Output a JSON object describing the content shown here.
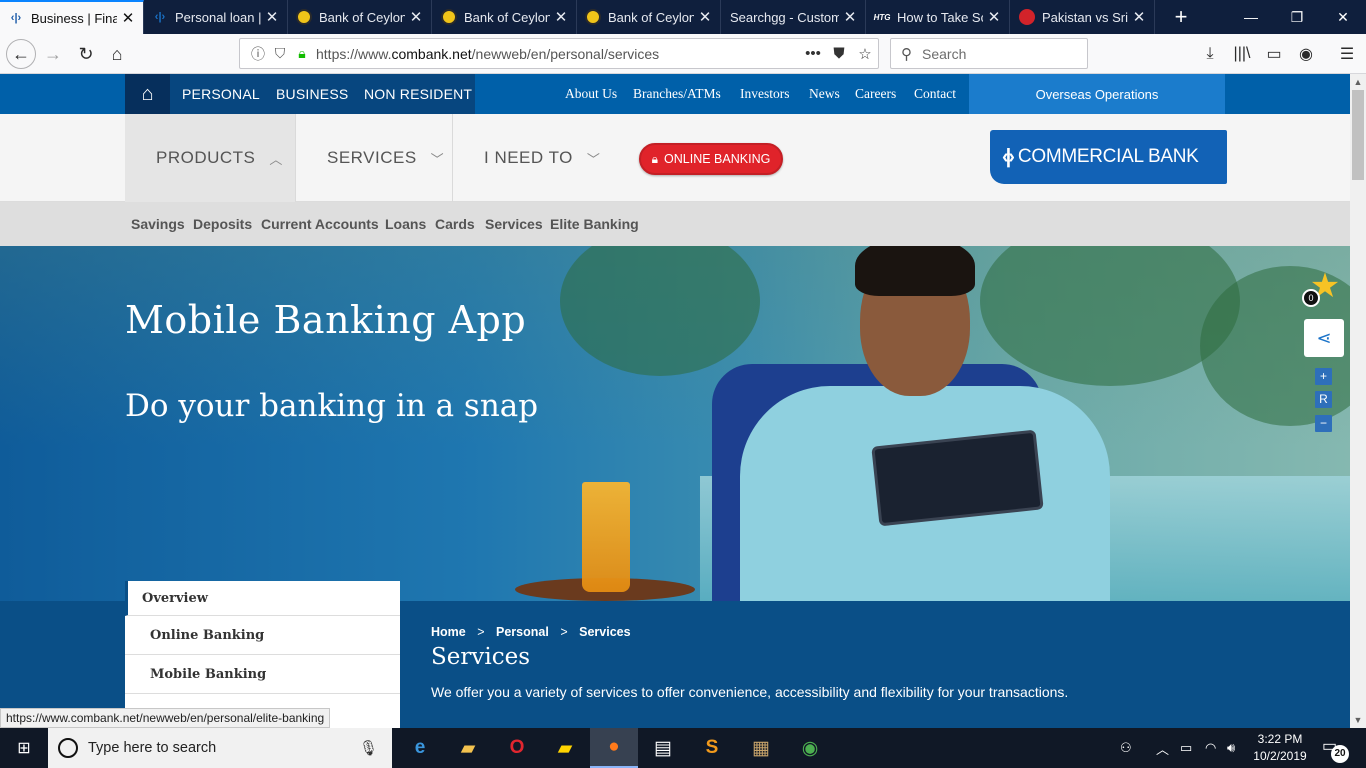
{
  "browser": {
    "tabs": [
      {
        "label": "Business | Finan",
        "favicon": "commercial-bank-icon",
        "active": true
      },
      {
        "label": "Personal loan | I",
        "favicon": "commercial-bank-icon",
        "active": false
      },
      {
        "label": "Bank of Ceylon",
        "favicon": "bank-of-ceylon-icon",
        "active": false
      },
      {
        "label": "Bank of Ceylon",
        "favicon": "bank-of-ceylon-icon",
        "active": false
      },
      {
        "label": "Bank of Ceylon",
        "favicon": "bank-of-ceylon-icon",
        "active": false
      },
      {
        "label": "Searchgg - Custom",
        "favicon": "",
        "active": false
      },
      {
        "label": "How to Take Sc",
        "favicon": "htg-icon",
        "active": false
      },
      {
        "label": "Pakistan vs Sri L",
        "favicon": "pakistan-icon",
        "active": false
      }
    ],
    "htg_favicon_text": "HTG",
    "url_prefix": "https://www.",
    "url_domain": "combank.net",
    "url_path": "/newweb/en/personal/services",
    "search_placeholder": "Search",
    "page_actions": "•••",
    "status_url": "https://www.combank.net/newweb/en/personal/elite-banking"
  },
  "site": {
    "segments": [
      "PERSONAL",
      "BUSINESS",
      "NON RESIDENT"
    ],
    "top_links": [
      "About Us",
      "Branches/ATMs",
      "Investors",
      "News",
      "Careers",
      "Contact"
    ],
    "overseas": "Overseas Operations",
    "main_menu": {
      "products": "PRODUCTS",
      "services": "SERVICES",
      "i_need_to": "I NEED TO"
    },
    "online_banking": "ONLINE BANKING",
    "logo_text": "COMMERCIAL BANK",
    "sub_menu": [
      "Savings",
      "Deposits",
      "Current Accounts",
      "Loans",
      "Cards",
      "Services",
      "Elite Banking"
    ],
    "hero": {
      "title": "Mobile Banking App",
      "subtitle": "Do your banking in a snap"
    },
    "favourites_count": "0",
    "font_tools": {
      "increase": "+",
      "reset": "R",
      "decrease": "−"
    },
    "side_nav": [
      "Overview",
      "Online Banking",
      "Mobile Banking"
    ],
    "breadcrumb": [
      "Home",
      "Personal",
      "Services"
    ],
    "breadcrumb_sep": ">",
    "page_title": "Services",
    "page_desc": "We offer you a variety of services to  offer convenience, accessibility and flexibility for your transactions."
  },
  "taskbar": {
    "search_placeholder": "Type here to search",
    "time": "3:22 PM",
    "date": "10/2/2019",
    "notifications": "20"
  },
  "colors": {
    "brand_blue": "#0060a9",
    "brand_dark": "#07467f",
    "online_banking_red": "#e0232a",
    "logo_blue": "#1262b6"
  }
}
